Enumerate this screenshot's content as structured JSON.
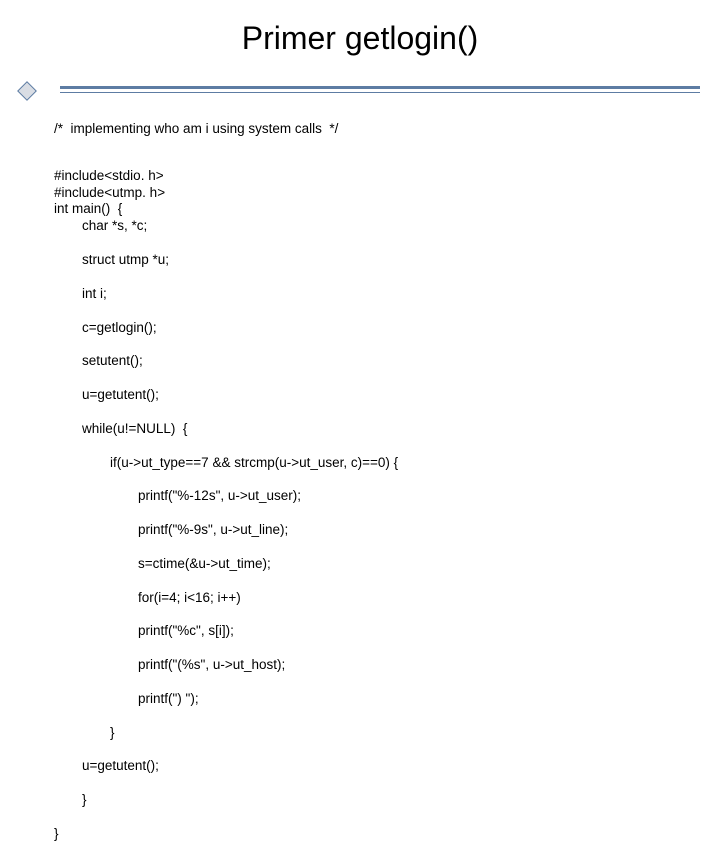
{
  "title": "Primer getlogin()",
  "code": {
    "l0": "/*  implementing who am i using system calls  */",
    "l1": "#include<stdio. h>",
    "l2": "#include<utmp. h>",
    "l3": "int main()  {",
    "l4": "char *s, *c;",
    "l5": "struct utmp *u;",
    "l6": "int i;",
    "l7": "c=getlogin();",
    "l8": "setutent();",
    "l9": "u=getutent();",
    "l10": "while(u!=NULL)  {",
    "l11": "if(u->ut_type==7 && strcmp(u->ut_user, c)==0) {",
    "l12": "printf(\"%-12s\", u->ut_user);",
    "l13": "printf(\"%-9s\", u->ut_line);",
    "l14": "s=ctime(&u->ut_time);",
    "l15": "for(i=4; i<16; i++)",
    "l16": "printf(\"%c\", s[i]);",
    "l17": "printf(\"(%s\", u->ut_host);",
    "l18": "printf(\") \");",
    "l19": "}",
    "l20": "u=getutent();",
    "l21": "}",
    "l22": "}"
  }
}
